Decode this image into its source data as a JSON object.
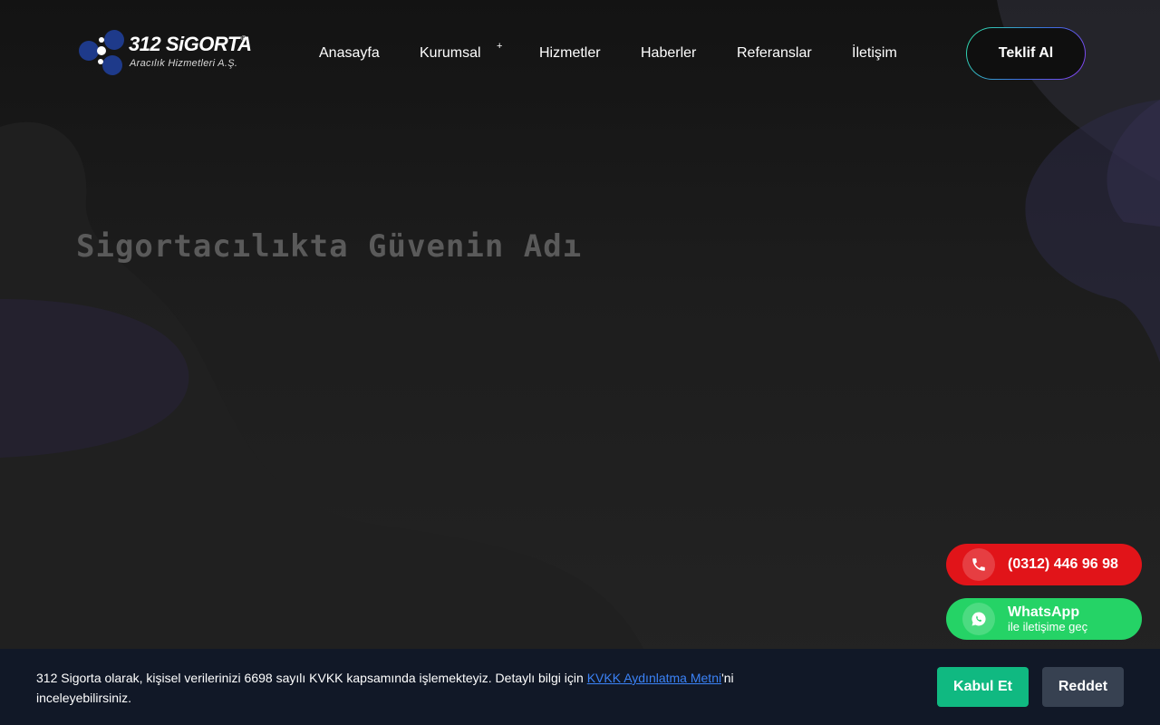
{
  "brand": {
    "title": "312 SiGORTA",
    "registered_mark": "®",
    "subtitle": "Aracılık Hizmetleri A.Ş.",
    "logo_color": "#1e3a8a"
  },
  "nav": {
    "items": [
      {
        "label": "Anasayfa"
      },
      {
        "label": "Kurumsal",
        "has_submenu": true,
        "submenu_indicator": "+"
      },
      {
        "label": "Hizmetler"
      },
      {
        "label": "Haberler"
      },
      {
        "label": "Referanslar"
      },
      {
        "label": "İletişim"
      }
    ],
    "cta_label": "Teklif Al"
  },
  "hero": {
    "title": "Sigortacılıkta Güvenin Adı"
  },
  "contact": {
    "phone_label": "(0312) 446 96 98",
    "phone_icon": "phone-icon",
    "whatsapp_title": "WhatsApp",
    "whatsapp_sub": "ile iletişime geç",
    "whatsapp_icon": "whatsapp-icon"
  },
  "cookie": {
    "text_before": "312 Sigorta olarak, kişisel verilerinizi 6698 sayılı KVKK kapsamında işlemekteyiz. Detaylı bilgi için ",
    "link_label": "KVKK Aydınlatma Metni",
    "text_after": "'ni inceleyebilirsiniz.",
    "accept_label": "Kabul Et",
    "reject_label": "Reddet"
  },
  "colors": {
    "phone_button": "#e11419",
    "whatsapp_button": "#25d366",
    "accept_button": "#10b981",
    "reject_button": "#374151",
    "cookie_background": "#111827",
    "link": "#3b82f6"
  }
}
